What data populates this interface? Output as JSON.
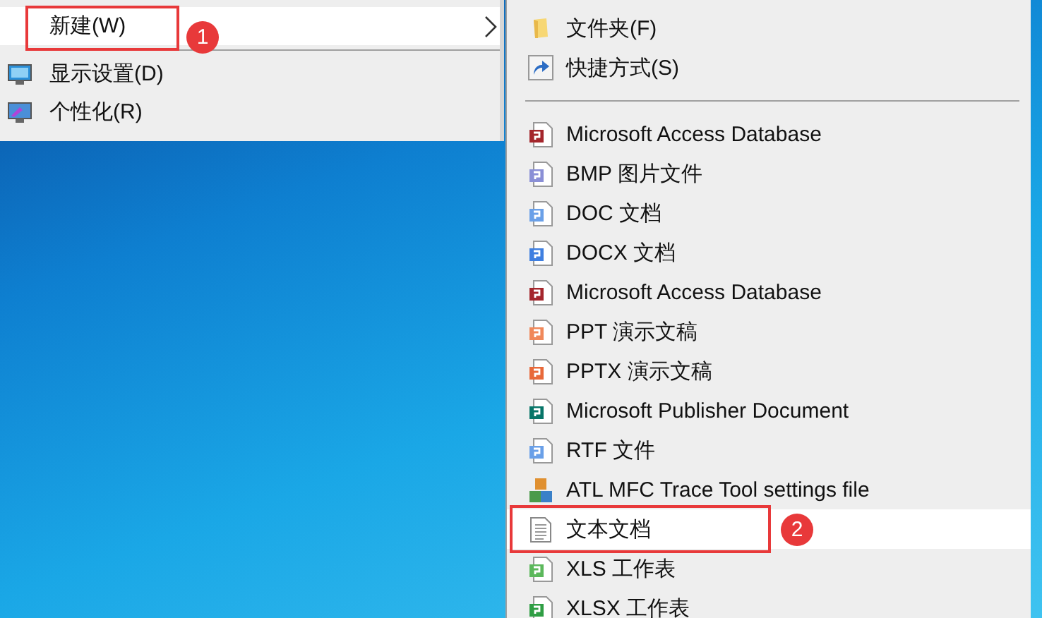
{
  "context_menu": {
    "items": [
      {
        "label": "新建(W)",
        "kind": "plain",
        "selected": true,
        "has_submenu": true,
        "marker": "1"
      },
      {
        "kind": "separator"
      },
      {
        "label": "显示设置(D)",
        "kind": "monitor",
        "selected": false,
        "has_submenu": false
      },
      {
        "label": "个性化(R)",
        "kind": "paint",
        "selected": false,
        "has_submenu": false
      }
    ]
  },
  "submenu": {
    "items": [
      {
        "label": "文件夹(F)",
        "kind": "folder",
        "selected": false
      },
      {
        "label": "快捷方式(S)",
        "kind": "shortcut",
        "selected": false
      },
      {
        "kind": "separator"
      },
      {
        "label": "Microsoft Access Database",
        "kind": "access",
        "selected": false
      },
      {
        "label": "BMP 图片文件",
        "kind": "image",
        "selected": false
      },
      {
        "label": "DOC 文档",
        "kind": "wordlight",
        "selected": false
      },
      {
        "label": "DOCX 文档",
        "kind": "word",
        "selected": false
      },
      {
        "label": "Microsoft Access Database",
        "kind": "access",
        "selected": false
      },
      {
        "label": "PPT 演示文稿",
        "kind": "pptlight",
        "selected": false
      },
      {
        "label": "PPTX 演示文稿",
        "kind": "ppt",
        "selected": false
      },
      {
        "label": "Microsoft Publisher Document",
        "kind": "publisher",
        "selected": false
      },
      {
        "label": "RTF 文件",
        "kind": "wordlight",
        "selected": false
      },
      {
        "label": "ATL MFC Trace Tool settings file",
        "kind": "blocks",
        "selected": false
      },
      {
        "label": "文本文档",
        "kind": "text",
        "selected": true,
        "marker": "2"
      },
      {
        "label": "XLS 工作表",
        "kind": "excellight",
        "selected": false
      },
      {
        "label": "XLSX 工作表",
        "kind": "excel",
        "selected": false
      }
    ]
  }
}
